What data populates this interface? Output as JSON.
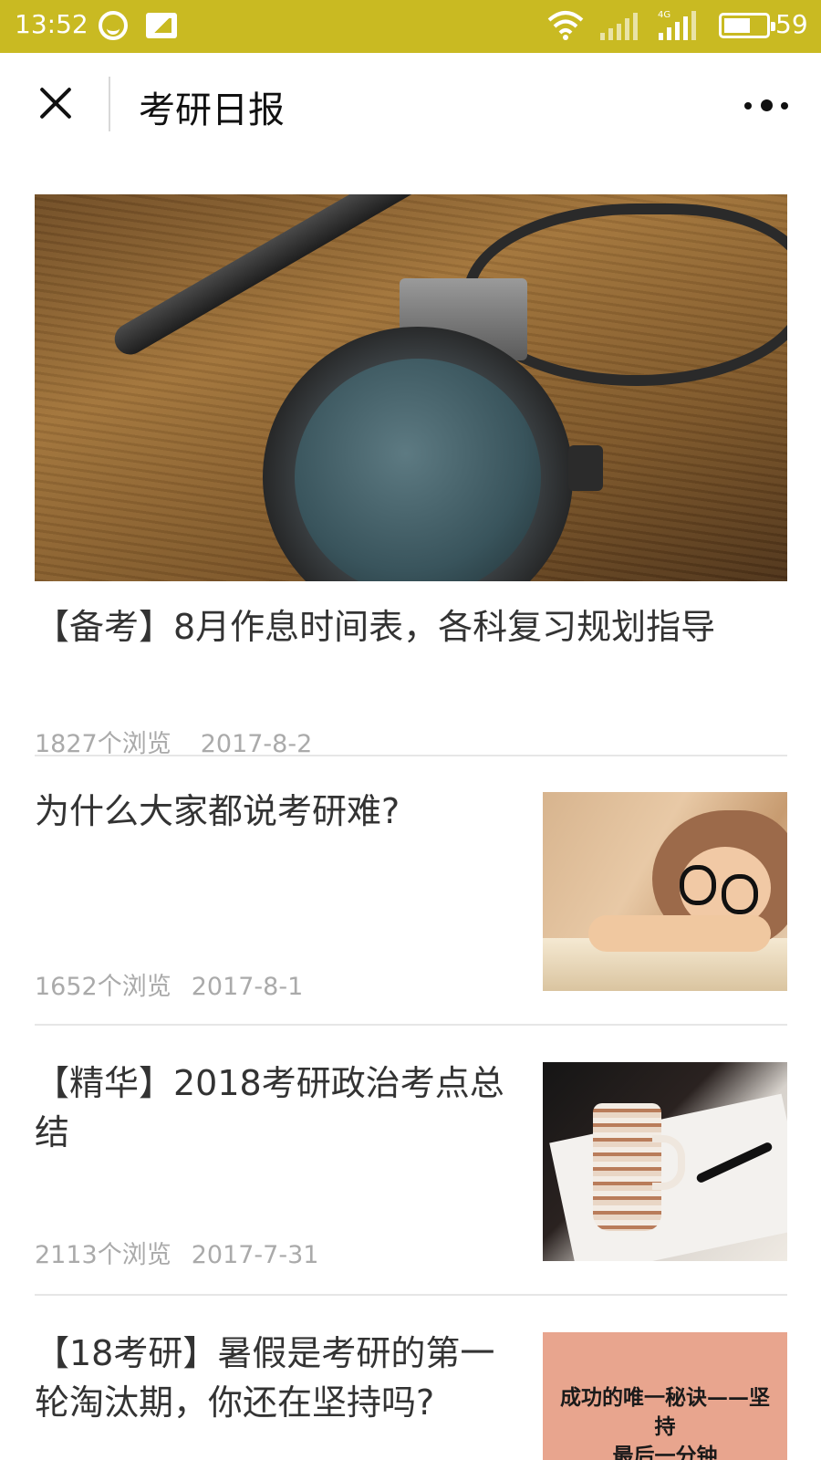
{
  "status_bar": {
    "time": "13:52",
    "battery_percent": "59",
    "background_color": "#c9ba22"
  },
  "title_bar": {
    "title": "考研日报",
    "close_icon": "close-icon",
    "more_icon": "more-dots-icon"
  },
  "featured": {
    "title": "【备考】8月作息时间表，各科复习规划指导",
    "views": "1827个浏览",
    "date": "2017-8-2"
  },
  "articles": [
    {
      "title": "为什么大家都说考研难?",
      "views": "1652个浏览",
      "date": "2017-8-1"
    },
    {
      "title": "【精华】2018考研政治考点总结",
      "views": "2113个浏览",
      "date": "2017-7-31"
    },
    {
      "title": "【18考研】暑假是考研的第一轮淘汰期，你还在坚持吗?",
      "thumb_text_line1": "成功的唯一秘诀——坚持",
      "thumb_text_line2": "最后一分钟"
    }
  ]
}
